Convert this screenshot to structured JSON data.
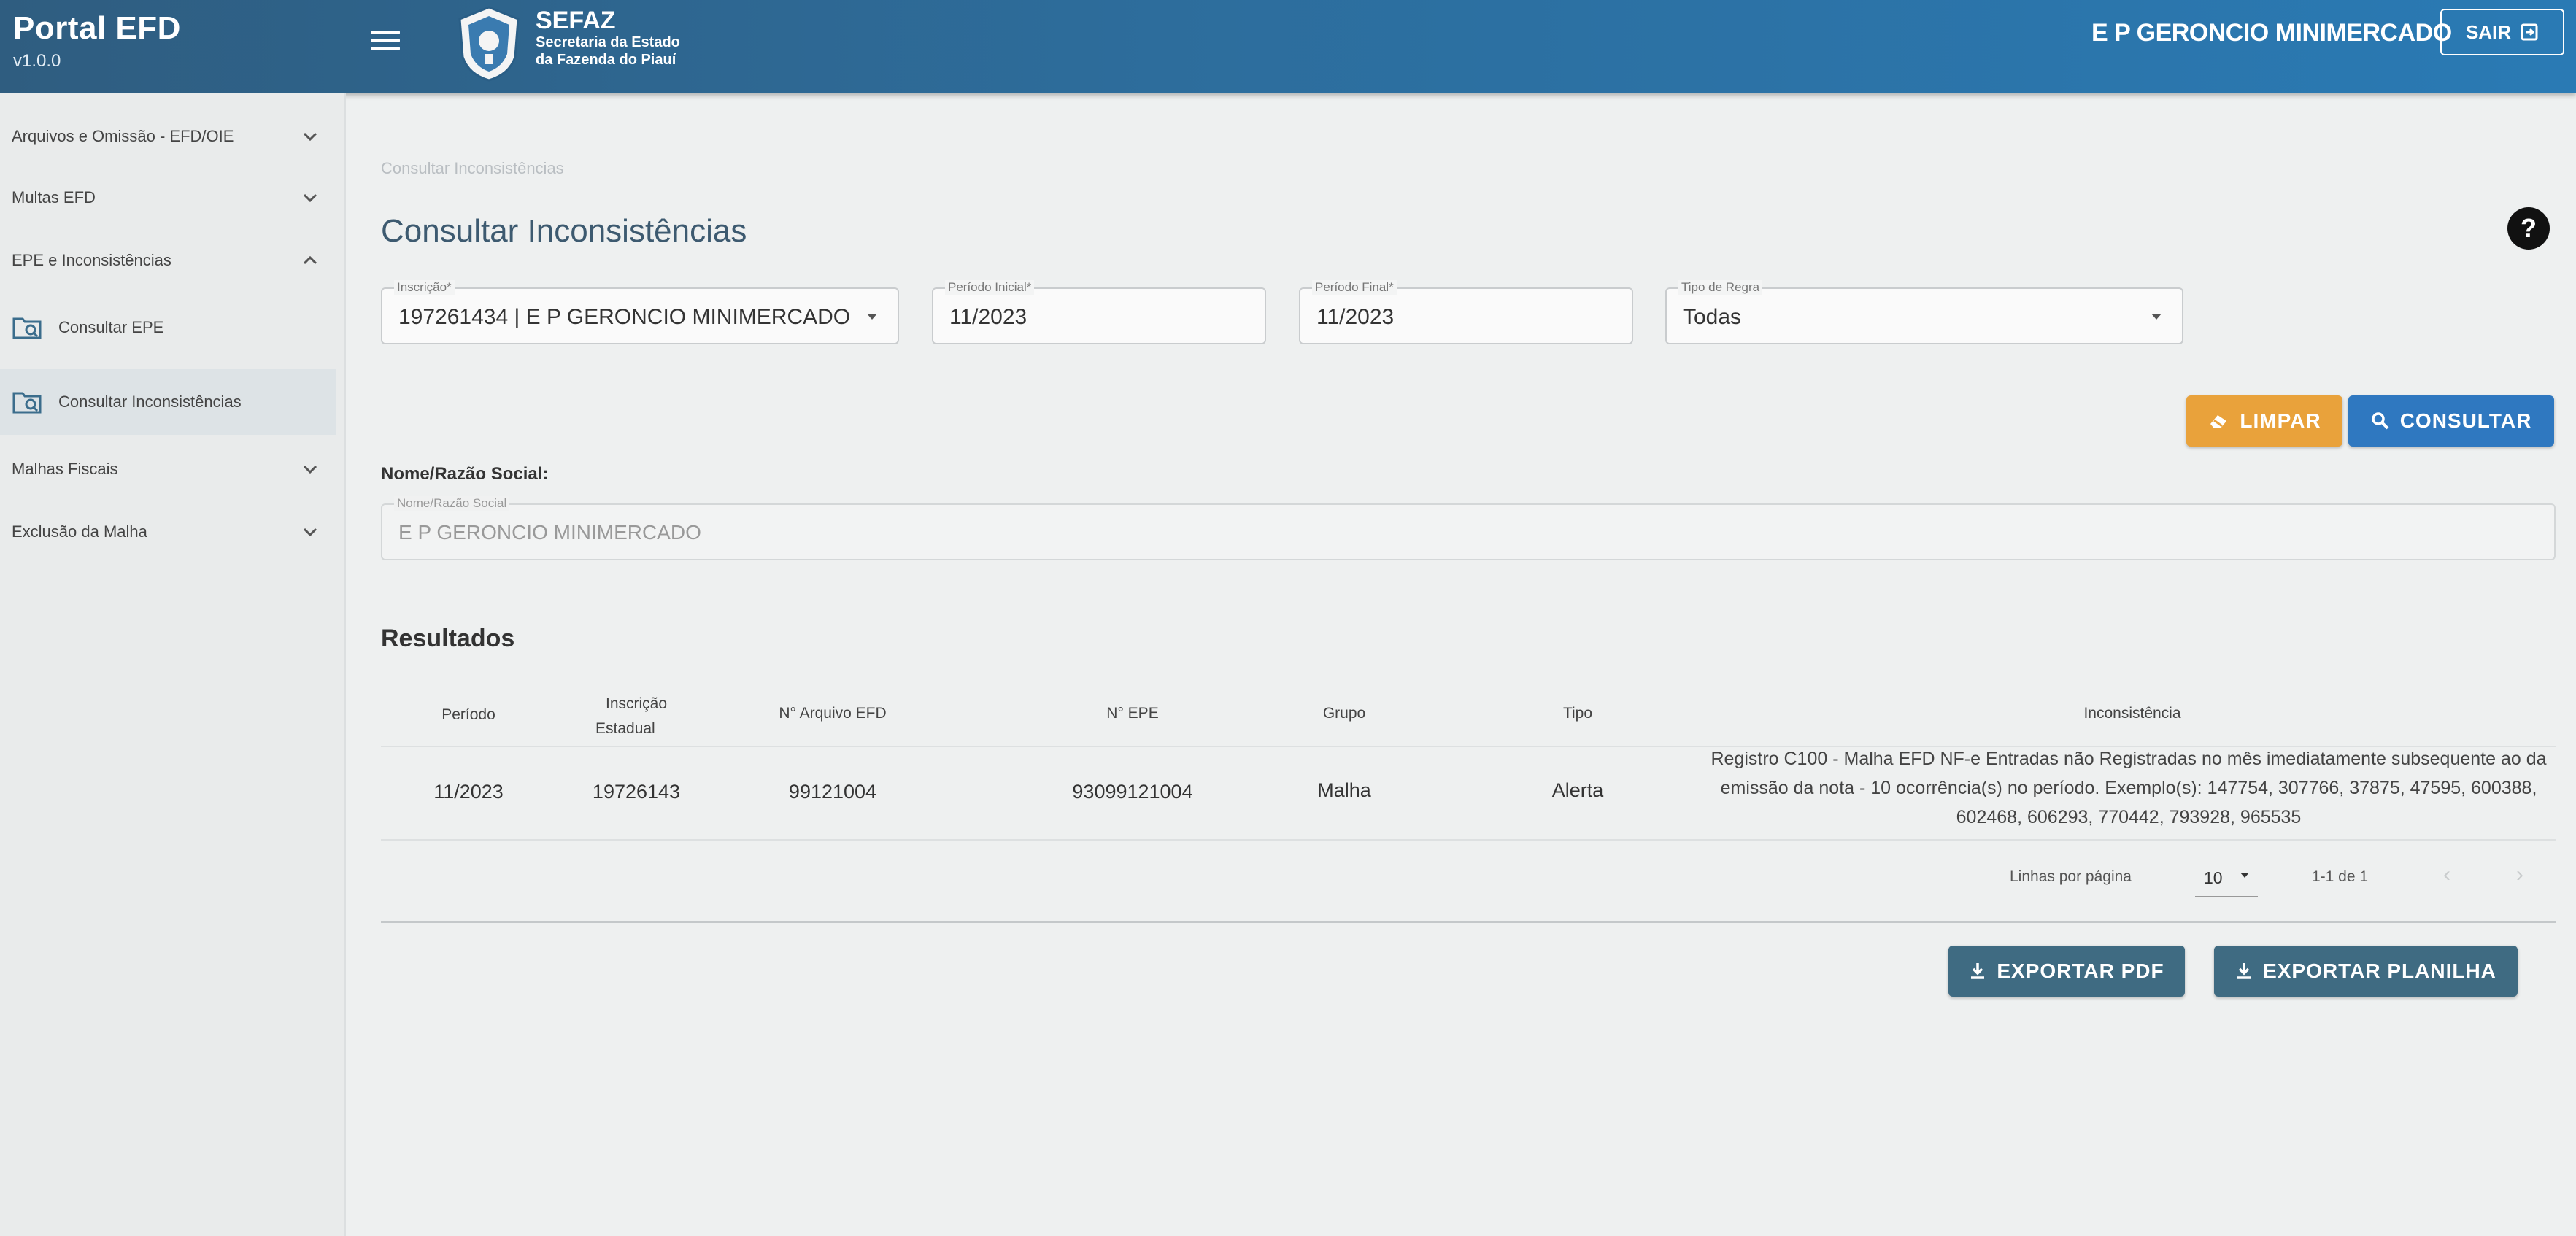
{
  "header": {
    "app_title": "Portal EFD",
    "version": "v1.0.0",
    "logo_title": "SEFAZ",
    "logo_line1": "Secretaria da Estado",
    "logo_line2": "da Fazenda do Piauí",
    "company_name": "E P GERONCIO MINIMERCADO",
    "logout_label": "SAIR"
  },
  "sidebar": {
    "items": [
      {
        "label": "Arquivos e Omissão - EFD/OIE"
      },
      {
        "label": "Multas EFD"
      },
      {
        "label": "EPE e Inconsistências"
      },
      {
        "label": "Consultar EPE"
      },
      {
        "label": "Consultar Inconsistências"
      },
      {
        "label": "Malhas Fiscais"
      },
      {
        "label": "Exclusão da Malha"
      }
    ]
  },
  "main": {
    "breadcrumb": "Consultar Inconsistências",
    "title": "Consultar Inconsistências",
    "filters": {
      "inscricao": {
        "label": "Inscrição*",
        "value": "197261434 | E P GERONCIO MINIMERCADO"
      },
      "periodo_inicial": {
        "label": "Período Inicial*",
        "value": "11/2023"
      },
      "periodo_final": {
        "label": "Período Final*",
        "value": "11/2023"
      },
      "tipo_regra": {
        "label": "Tipo de Regra",
        "value": "Todas"
      }
    },
    "buttons": {
      "limpar": "LIMPAR",
      "consultar": "CONSULTAR",
      "exportar_pdf": "EXPORTAR PDF",
      "exportar_planilha": "EXPORTAR PLANILHA"
    },
    "nome_section_label": "Nome/Razão Social:",
    "nome_field": {
      "label": "Nome/Razão Social",
      "value": "E P GERONCIO MINIMERCADO"
    },
    "results_title": "Resultados",
    "table": {
      "headers": {
        "periodo": "Período",
        "inscricao_l1": "Inscrição",
        "inscricao_l2": "Estadual",
        "arquivo": "N° Arquivo EFD",
        "epe": "N° EPE",
        "grupo": "Grupo",
        "tipo": "Tipo",
        "inconsistencia": "Inconsistência"
      },
      "rows": [
        {
          "periodo": "11/2023",
          "inscricao": "19726143",
          "arquivo": "99121004",
          "epe": "93099121004",
          "grupo": "Malha",
          "tipo": "Alerta",
          "inconsistencia": "Registro C100 - Malha EFD NF-e Entradas não Registradas no mês imediatamente subsequente ao da emissão da nota - 10 ocorrência(s) no período. Exemplo(s): 147754, 307766, 37875, 47595, 600388, 602468, 606293, 770442, 793928, 965535"
        }
      ],
      "pagination": {
        "rows_per_page_label": "Linhas por página",
        "rows_per_page_value": "10",
        "range": "1-1 de 1"
      }
    }
  }
}
